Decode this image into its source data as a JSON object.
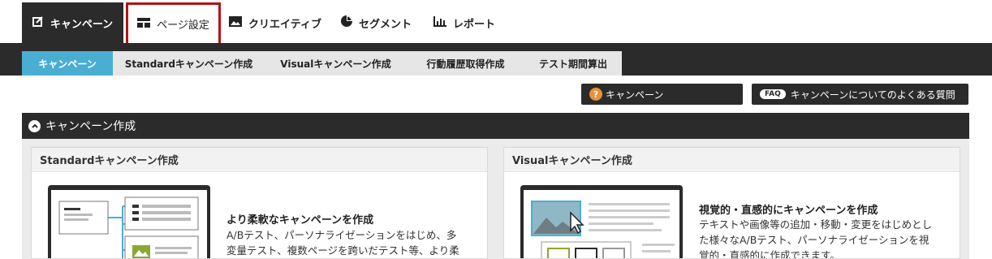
{
  "topnav": {
    "tabs": [
      {
        "label": "キャンペーン",
        "icon": "campaign-edit-icon"
      },
      {
        "label": "ページ設定",
        "icon": "page-layout-icon"
      },
      {
        "label": "クリエイティブ",
        "icon": "image-icon"
      },
      {
        "label": "セグメント",
        "icon": "pie-chart-icon"
      },
      {
        "label": "レポート",
        "icon": "bar-chart-icon"
      }
    ]
  },
  "subnav": {
    "items": [
      {
        "label": "キャンペーン"
      },
      {
        "label": "Standardキャンペーン作成"
      },
      {
        "label": "Visualキャンペーン作成"
      },
      {
        "label": "行動履歴取得作成"
      },
      {
        "label": "テスト期間算出"
      }
    ]
  },
  "help": {
    "campaign_label": "キャンペーン",
    "question_mark": "?",
    "faq_badge": "FAQ",
    "faq_label": "キャンペーンについてのよくある質問"
  },
  "section": {
    "title": "キャンペーン作成"
  },
  "cards": {
    "standard": {
      "title": "Standardキャンペーン作成",
      "heading": "より柔軟なキャンペーンを作成",
      "desc_line1": "A/Bテスト、パーソナライゼーションをはじめ、多",
      "desc_line2": "変量テスト、複数ページを跨いだテスト等、より柔"
    },
    "visual": {
      "title": "Visualキャンペーン作成",
      "heading": "視覚的・直感的にキャンペーンを作成",
      "desc_line1": "テキストや画像等の追加・移動・変更をはじめとし",
      "desc_line2": "た様々なA/Bテスト、パーソナライゼーションを視",
      "desc_line3": "覚的・直感的に作成できます。"
    }
  },
  "colors": {
    "dark": "#2b2b2b",
    "accent": "#4aaed3",
    "highlight_border": "#b31217",
    "help_icon": "#e8913c"
  }
}
